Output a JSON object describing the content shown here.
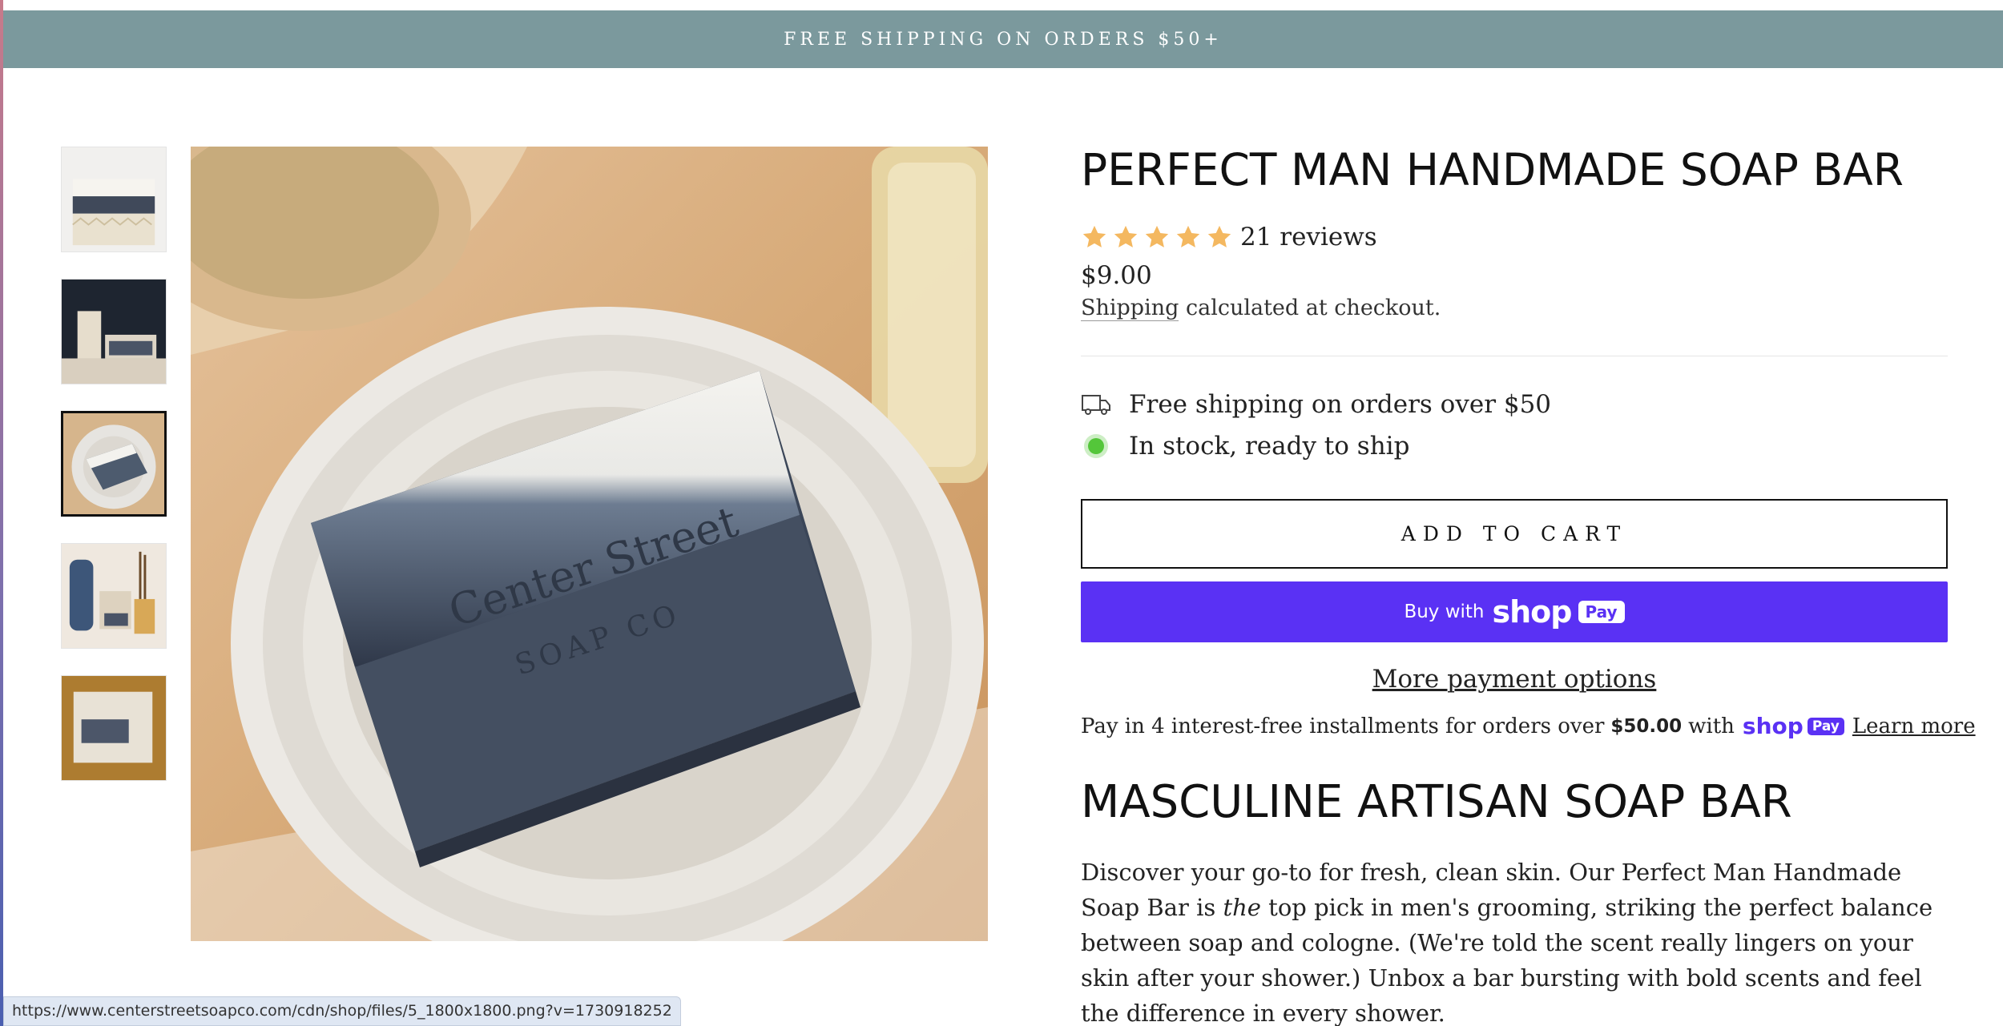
{
  "announcement": "FREE SHIPPING ON ORDERS $50+",
  "product": {
    "title": "PERFECT MAN HANDMADE SOAP BAR",
    "rating": 5,
    "reviews_label": "21 reviews",
    "price": "$9.00",
    "shipping_link": "Shipping",
    "shipping_text": " calculated at checkout."
  },
  "features": [
    {
      "icon": "truck-icon",
      "text": "Free shipping on orders over $50"
    },
    {
      "icon": "in-stock-dot-icon",
      "text": "In stock, ready to ship"
    }
  ],
  "buttons": {
    "add_to_cart": "ADD TO CART",
    "buy_with": "Buy with",
    "shop_logo": "shop",
    "pay_pill": "Pay",
    "more_payment": "More payment options"
  },
  "installments": {
    "prefix": "Pay in 4 interest-free installments for orders over",
    "amount": "$50.00",
    "with": "with",
    "logo": "shop",
    "pill": "Pay",
    "learn_more": "Learn more"
  },
  "section": {
    "heading": "MASCULINE ARTISAN SOAP BAR",
    "desc_1": "Discover your go-to for fresh, clean skin. Our Perfect Man Handmade Soap Bar is ",
    "desc_em": "the",
    "desc_2": " top pick in men's grooming, striking the perfect balance between soap and cologne. (We're told the scent really lingers on your skin after your shower.) Unbox a bar bursting with bold scents and feel the difference in every shower."
  },
  "stamp_text": {
    "line1": "Center Street",
    "line2": "SOAP CO"
  },
  "status_url": "https://www.centerstreetsoapco.com/cdn/shop/files/5_1800x1800.png?v=1730918252",
  "colors": {
    "announcement_bg": "#7b999d",
    "shop_pay": "#5a31f4",
    "star": "#f4b860",
    "stock_dot": "#54c63a"
  }
}
